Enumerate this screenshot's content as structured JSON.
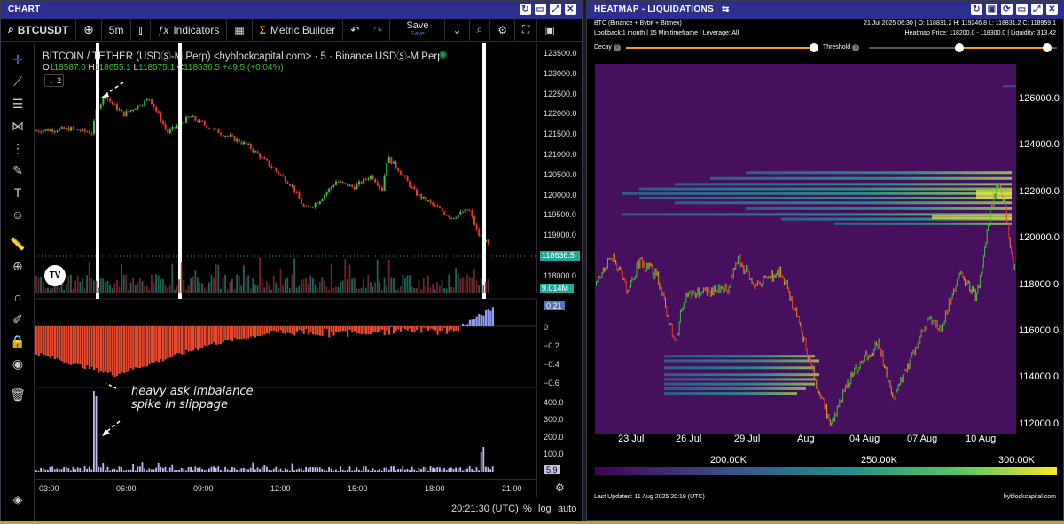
{
  "chart_panel": {
    "title": "CHART",
    "toolbar": {
      "symbol": "BTCUSDT",
      "interval": "5m",
      "indicators": "Indicators",
      "metric_builder": "Metric Builder",
      "save": "Save",
      "save_sub": "Save"
    },
    "legend": {
      "name": "BITCOIN / TETHER (USDⓈ-M Perp) <hyblockcapital.com> · 5 · Binance USDⓈ-M Perp",
      "o_label": "O",
      "o_value": "118587.0",
      "h_label": "H",
      "h_value": "118655.1",
      "l_label": "L",
      "l_value": "118575.1",
      "c_label": "C",
      "c_value": "118636.5",
      "change": "+49.5 (+0.04%)",
      "collapse_count": "2"
    },
    "price_axis": [
      "123500.0",
      "123000.0",
      "122500.0",
      "122000.0",
      "121500.0",
      "121000.0",
      "120500.0",
      "120000.0",
      "119500.0",
      "119000.0",
      "118500.0",
      "118000.0"
    ],
    "last_price": "118636.5",
    "volume_label": "9.014M",
    "imbalance_axis": [
      "0.21",
      "0",
      "−0.2",
      "−0.4",
      "−0.6"
    ],
    "slippage_axis": [
      "400.0",
      "300.0",
      "200.0",
      "100.0",
      "5.9"
    ],
    "time_axis": [
      "03:00",
      "06:00",
      "09:00",
      "12:00",
      "15:00",
      "18:00",
      "21:00"
    ],
    "annotation": "heavy ask imbalance spike in slippage",
    "annotation_line1": "heavy ask imbalance",
    "annotation_line2": "spike in slippage",
    "clock": "20:21:30 (UTC)",
    "pct": "%",
    "log": "log",
    "auto": "auto",
    "colors": {
      "up": "#26a69a",
      "down": "#ef5350",
      "green_candle": "#3fbf3f",
      "red_candle": "#e8392e"
    }
  },
  "heatmap_panel": {
    "title": "HEATMAP - LIQUIDATIONS",
    "info_left_1": "BTC (Binance + Bybit + Bitmex)",
    "info_left_2": "Lookback:1 month | 15 Min timeframe | Leverage: All",
    "info_right_1": "21 Jul 2025 06:30 | O: 118831.2 H: 119246.8 L: 118831.2 C: 118959.1",
    "info_right_2": "Heatmap Price: 118200.0 - 118300.0 | Liquidity: 313.42",
    "decay_label": "Decay",
    "threshold_label": "Threshold",
    "price_axis": [
      "126000.0",
      "124000.0",
      "122000.0",
      "120000.0",
      "118000.0",
      "116000.0",
      "114000.0",
      "112000.0"
    ],
    "date_axis": [
      "23 Jul",
      "26 Jul",
      "29 Jul",
      "Aug",
      "04 Aug",
      "07 Aug",
      "10 Aug"
    ],
    "colorbar": [
      "200.00K",
      "250.00K",
      "300.00K"
    ],
    "last_updated": "Last Updated: 11 Aug 2025 20:19 (UTC)",
    "watermark": "hyblockcapital.com",
    "colors": {
      "background": "#46105e",
      "low": "#3b528b",
      "mid": "#21a585",
      "high": "#fde725"
    }
  }
}
